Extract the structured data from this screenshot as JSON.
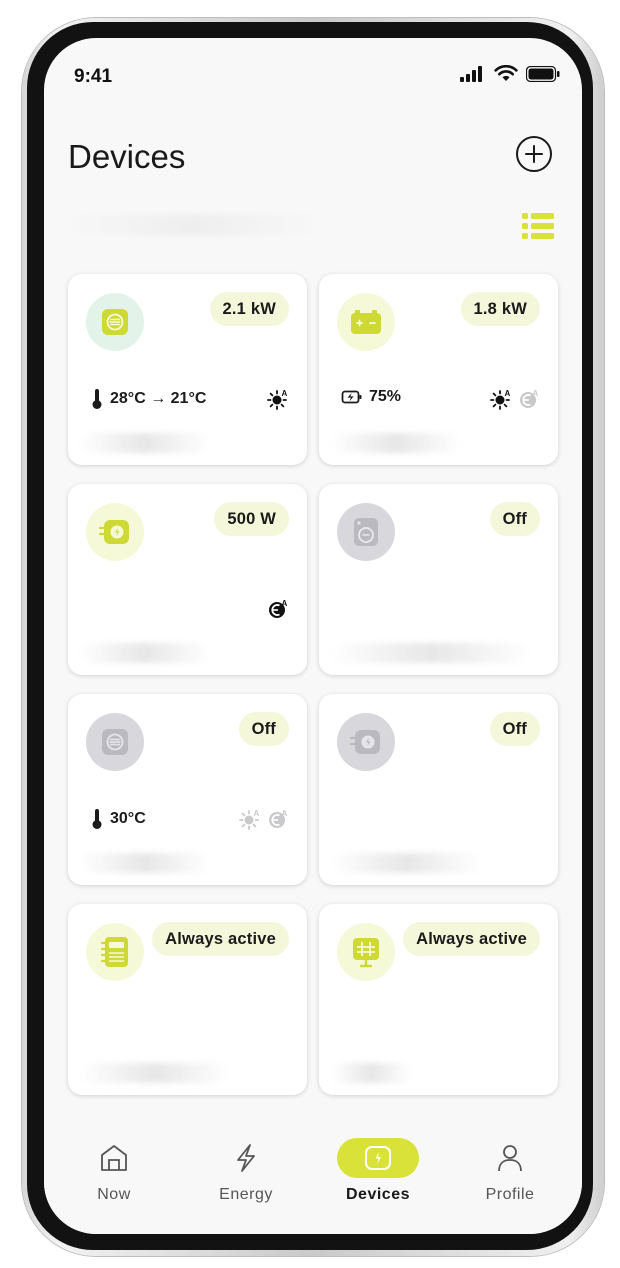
{
  "status_bar": {
    "time": "9:41"
  },
  "header": {
    "title": "Devices"
  },
  "devices": [
    {
      "power": "2.1 kW",
      "icon": "heater-icon",
      "status": "active",
      "meta_icon": "thermometer-icon",
      "meta": "28°C → 21°C",
      "modes": [
        "solar-auto-icon"
      ]
    },
    {
      "power": "1.8 kW",
      "icon": "battery-icon",
      "status": "active",
      "meta_icon": "battery-charging-icon",
      "meta": "75%",
      "modes": [
        "solar-auto-icon",
        "grid-auto-icon"
      ]
    },
    {
      "power": "500 W",
      "icon": "wallbox-icon",
      "status": "active",
      "meta": "",
      "modes": [
        "grid-auto-icon"
      ]
    },
    {
      "power": "Off",
      "icon": "washing-machine-icon",
      "status": "off",
      "meta": "",
      "modes": []
    },
    {
      "power": "Off",
      "icon": "heater-icon",
      "status": "off",
      "meta_icon": "thermometer-icon",
      "meta": "30°C",
      "modes": [
        "solar-auto-icon",
        "grid-auto-icon"
      ]
    },
    {
      "power": "Off",
      "icon": "wallbox-icon",
      "status": "off",
      "meta": "",
      "modes": []
    },
    {
      "power": "Always active",
      "icon": "meter-icon",
      "status": "always",
      "meta": "",
      "modes": []
    },
    {
      "power": "Always active",
      "icon": "inverter-icon",
      "status": "always",
      "meta": "",
      "modes": []
    }
  ],
  "nav": {
    "items": [
      {
        "label": "Now",
        "icon": "house-icon"
      },
      {
        "label": "Energy",
        "icon": "lightning-icon"
      },
      {
        "label": "Devices",
        "icon": "device-icon",
        "active": true
      },
      {
        "label": "Profile",
        "icon": "person-icon"
      }
    ]
  },
  "colors": {
    "accent": "#d8e238",
    "icon_accent": "#cfd935",
    "pill_bg": "#f4f7da",
    "off_gray": "#b9b9bf"
  }
}
